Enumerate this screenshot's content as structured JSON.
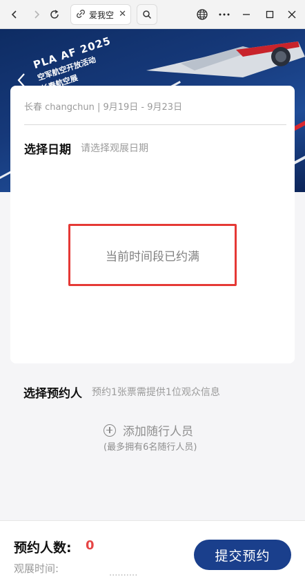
{
  "browser": {
    "tab_title": "爱我空",
    "tab_close": "✕",
    "icons": [
      "back-icon",
      "forward-icon",
      "refresh-icon",
      "link-icon",
      "search-icon",
      "globe-icon",
      "more-icon",
      "minimize-icon",
      "maximize-icon",
      "close-icon"
    ]
  },
  "hero": {
    "line1": "PLA AF 2025",
    "line2": "空军航空开放活动",
    "line3": "长春航空展"
  },
  "card": {
    "location": "长春 changchun | 9月19日 - 9月23日",
    "date_title": "选择日期",
    "date_hint": "请选择观展日期",
    "full_message": "当前时间段已约满"
  },
  "visitors": {
    "title": "选择预约人",
    "hint": "预约1张票需提供1位观众信息",
    "add_label": "添加随行人员",
    "add_note": "(最多拥有6名随行人员)"
  },
  "footer": {
    "count_label": "预约人数:",
    "count_value": "0",
    "time_label": "观展时间:",
    "submit_label": "提交预约",
    "watermark": "··········"
  },
  "colors": {
    "accent": "#1a3f8c",
    "alert_border": "#e53935",
    "count": "#e64545"
  }
}
